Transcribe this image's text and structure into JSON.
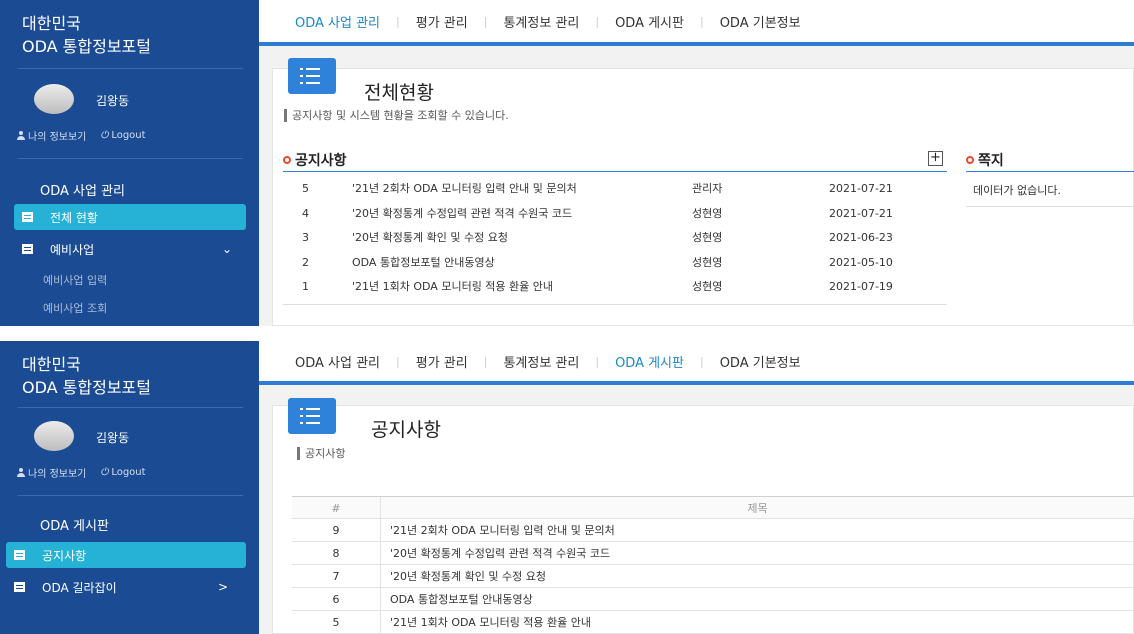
{
  "brand": {
    "line1": "대한민국",
    "line2": "ODA 통합정보포털"
  },
  "user": {
    "name": "김왕동",
    "my_info": "나의 정보보기",
    "logout": "Logout"
  },
  "icons": {
    "menu": "hamburger-list-icon",
    "doc": "document-icon",
    "person": "person-icon",
    "power": "power-icon",
    "circle": "circle-bullet-icon",
    "plus": "plus-icon",
    "chevron": "chevron-icon"
  },
  "colors": {
    "sidebar": "#1b4b93",
    "active_item": "#25b2d6",
    "accent": "#2e82d9",
    "nav_active": "#1a88c9",
    "bullet": "#e84a2e"
  },
  "nav": {
    "items": [
      "ODA 사업 관리",
      "평가 관리",
      "통계정보 관리",
      "ODA 게시판",
      "ODA 기본정보"
    ]
  },
  "screen1": {
    "nav_active": 0,
    "sidebar": {
      "section": "ODA 사업 관리",
      "items": [
        {
          "label": "전체 현황",
          "active": true
        },
        {
          "label": "예비사업",
          "active": false,
          "chevron": "⌄"
        }
      ],
      "subitems": [
        "예비사업 입력",
        "예비사업 조회"
      ]
    },
    "page": {
      "title": "전체현황",
      "desc": "공지사항 및 시스템 현황을 조회할 수 있습니다."
    },
    "notices": {
      "title": "공지사항",
      "plus": "+",
      "rows": [
        {
          "no": "5",
          "title": "'21년 2회차 ODA 모니터링 입력 안내 및 문의처",
          "author": "관리자",
          "date": "2021-07-21"
        },
        {
          "no": "4",
          "title": "'20년 확정통계 수정입력 관련 적격 수원국 코드",
          "author": "성현영",
          "date": "2021-07-21"
        },
        {
          "no": "3",
          "title": "'20년 확정통계 확인 및 수정 요청",
          "author": "성현영",
          "date": "2021-06-23"
        },
        {
          "no": "2",
          "title": "ODA 통합정보포털 안내동영상",
          "author": "성현영",
          "date": "2021-05-10"
        },
        {
          "no": "1",
          "title": "'21년 1회차 ODA 모니터링 적용 환율 안내",
          "author": "성현영",
          "date": "2021-07-19"
        }
      ]
    },
    "messages": {
      "title": "쪽지",
      "empty": "데이터가 없습니다."
    }
  },
  "screen2": {
    "nav_active": 3,
    "sidebar": {
      "section": "ODA 게시판",
      "items": [
        {
          "label": "공지사항",
          "active": true
        },
        {
          "label": "ODA 길라잡이",
          "active": false,
          "chevron": ">"
        }
      ]
    },
    "page": {
      "title": "공지사항",
      "desc": "공지사항"
    },
    "table": {
      "headers": [
        "#",
        "제목"
      ],
      "rows": [
        {
          "no": "9",
          "title": "'21년 2회차 ODA 모니터링 입력 안내 및 문의처"
        },
        {
          "no": "8",
          "title": "'20년 확정통계 수정입력 관련 적격 수원국 코드"
        },
        {
          "no": "7",
          "title": "'20년 확정통계 확인 및 수정 요청"
        },
        {
          "no": "6",
          "title": "ODA 통합정보포털 안내동영상"
        },
        {
          "no": "5",
          "title": "'21년 1회차 ODA 모니터링 적용 환율 안내"
        }
      ]
    }
  }
}
